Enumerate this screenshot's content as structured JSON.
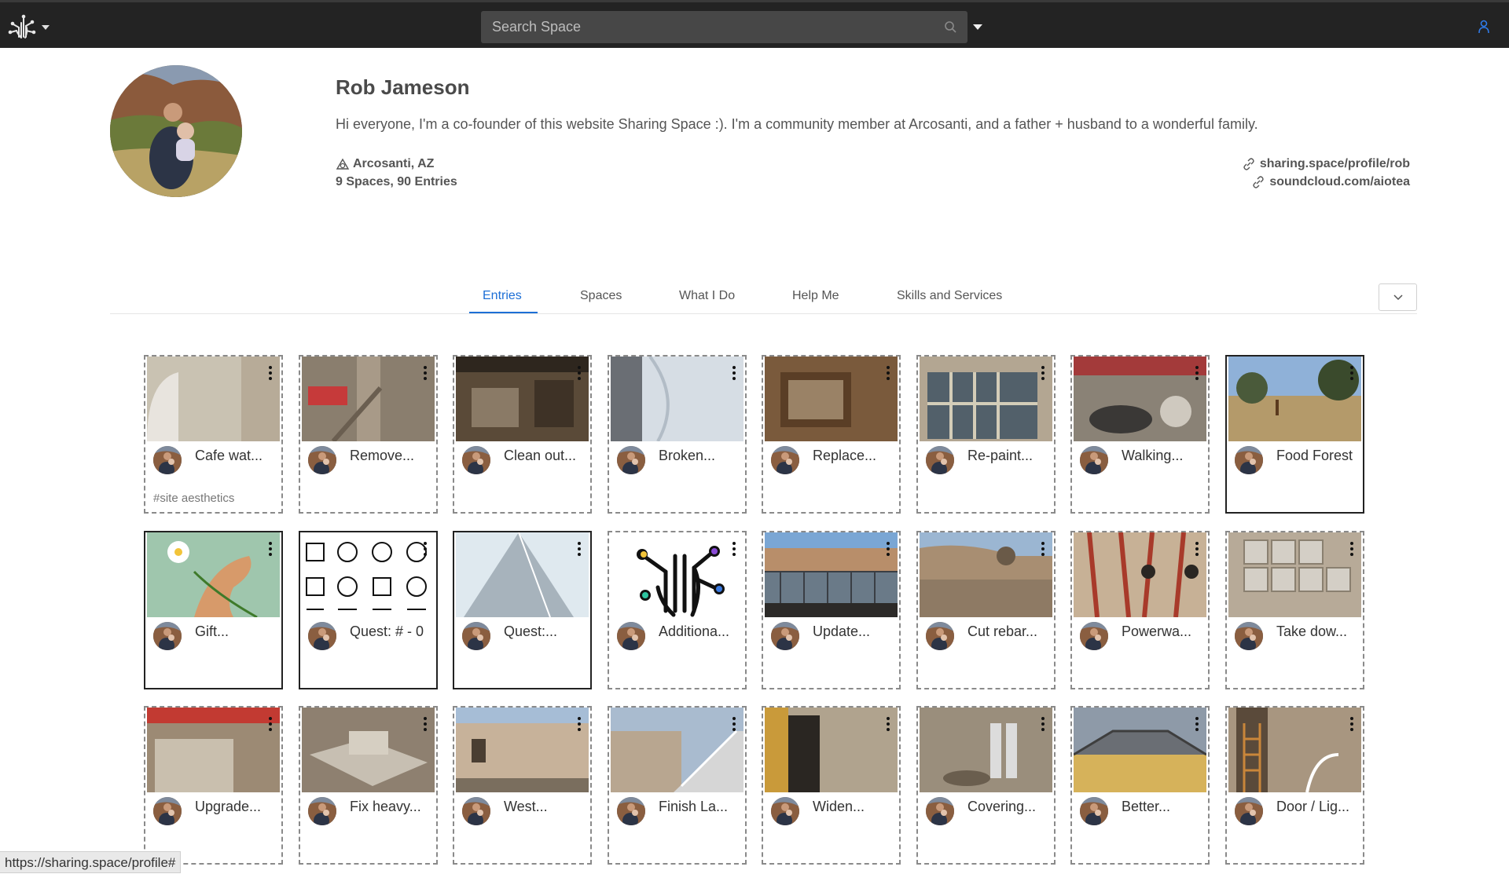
{
  "search": {
    "placeholder": "Search Space"
  },
  "profile": {
    "name": "Rob Jameson",
    "bio": "Hi everyone, I'm a co-founder of this website Sharing Space :). I'm a community member at Arcosanti, and a father + husband to a wonderful family.",
    "location": "Arcosanti, AZ",
    "stats": "9 Spaces, 90 Entries",
    "links": [
      "sharing.space/profile/rob",
      "soundcloud.com/aiotea"
    ]
  },
  "tabs": [
    {
      "label": "Entries",
      "active": true
    },
    {
      "label": "Spaces",
      "active": false
    },
    {
      "label": "What I Do",
      "active": false
    },
    {
      "label": "Help Me",
      "active": false
    },
    {
      "label": "Skills and Services",
      "active": false
    }
  ],
  "cards": [
    {
      "title": "Cafe wat...",
      "tag": "#site aesthetics",
      "style": "dashed",
      "thumb": "wall"
    },
    {
      "title": "Remove...",
      "tag": "",
      "style": "dashed",
      "thumb": "sign"
    },
    {
      "title": "Clean out...",
      "tag": "",
      "style": "dashed",
      "thumb": "room"
    },
    {
      "title": "Broken...",
      "tag": "",
      "style": "dashed",
      "thumb": "glass"
    },
    {
      "title": "Replace...",
      "tag": "",
      "style": "dashed",
      "thumb": "wood"
    },
    {
      "title": "Re-paint...",
      "tag": "",
      "style": "dashed",
      "thumb": "window"
    },
    {
      "title": "Walking...",
      "tag": "",
      "style": "dashed",
      "thumb": "yard"
    },
    {
      "title": "Food Forest",
      "tag": "",
      "style": "solid",
      "thumb": "forest"
    },
    {
      "title": "Gift...",
      "tag": "",
      "style": "solid",
      "thumb": "gift"
    },
    {
      "title": "Quest: # - 0",
      "tag": "",
      "style": "solid",
      "thumb": "quest"
    },
    {
      "title": "Quest:...",
      "tag": "",
      "style": "solid",
      "thumb": "tower"
    },
    {
      "title": "Additiona...",
      "tag": "",
      "style": "dashed",
      "thumb": "hand"
    },
    {
      "title": "Update...",
      "tag": "",
      "style": "dashed",
      "thumb": "balcony"
    },
    {
      "title": "Cut rebar...",
      "tag": "",
      "style": "dashed",
      "thumb": "concrete"
    },
    {
      "title": "Powerwa...",
      "tag": "",
      "style": "dashed",
      "thumb": "mural"
    },
    {
      "title": "Take dow...",
      "tag": "",
      "style": "dashed",
      "thumb": "tiles"
    },
    {
      "title": "Upgrade...",
      "tag": "",
      "style": "dashed",
      "thumb": "wall2"
    },
    {
      "title": "Fix heavy...",
      "tag": "",
      "style": "dashed",
      "thumb": "slab"
    },
    {
      "title": "West...",
      "tag": "",
      "style": "dashed",
      "thumb": "building"
    },
    {
      "title": "Finish La...",
      "tag": "",
      "style": "dashed",
      "thumb": "stairs"
    },
    {
      "title": "Widen...",
      "tag": "",
      "style": "dashed",
      "thumb": "door"
    },
    {
      "title": "Covering...",
      "tag": "",
      "style": "dashed",
      "thumb": "pipes"
    },
    {
      "title": "Better...",
      "tag": "",
      "style": "dashed",
      "thumb": "roof"
    },
    {
      "title": "Door / Lig...",
      "tag": "",
      "style": "dashed",
      "thumb": "ladder"
    }
  ],
  "status_url": "https://sharing.space/profile#",
  "colors": {
    "accent": "#1d6fd6",
    "topbar": "#232323"
  }
}
